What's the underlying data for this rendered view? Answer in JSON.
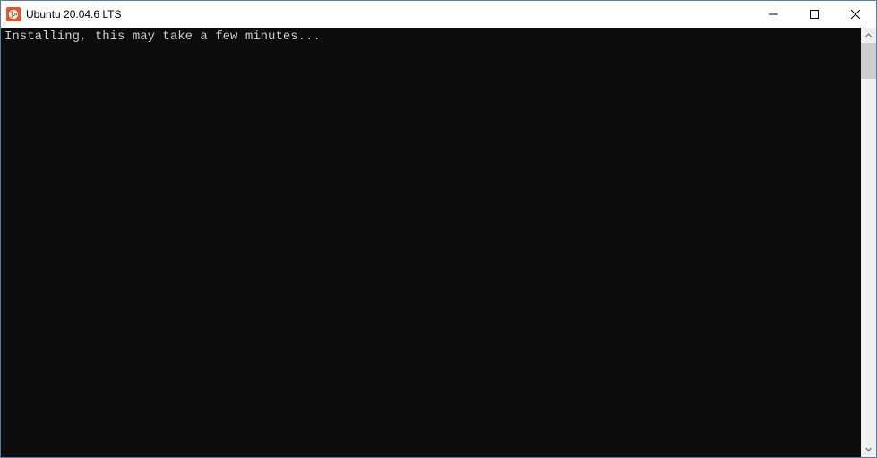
{
  "window": {
    "title": "Ubuntu 20.04.6 LTS",
    "icon": "ubuntu-icon"
  },
  "terminal": {
    "line1": "Installing, this may take a few minutes..."
  }
}
